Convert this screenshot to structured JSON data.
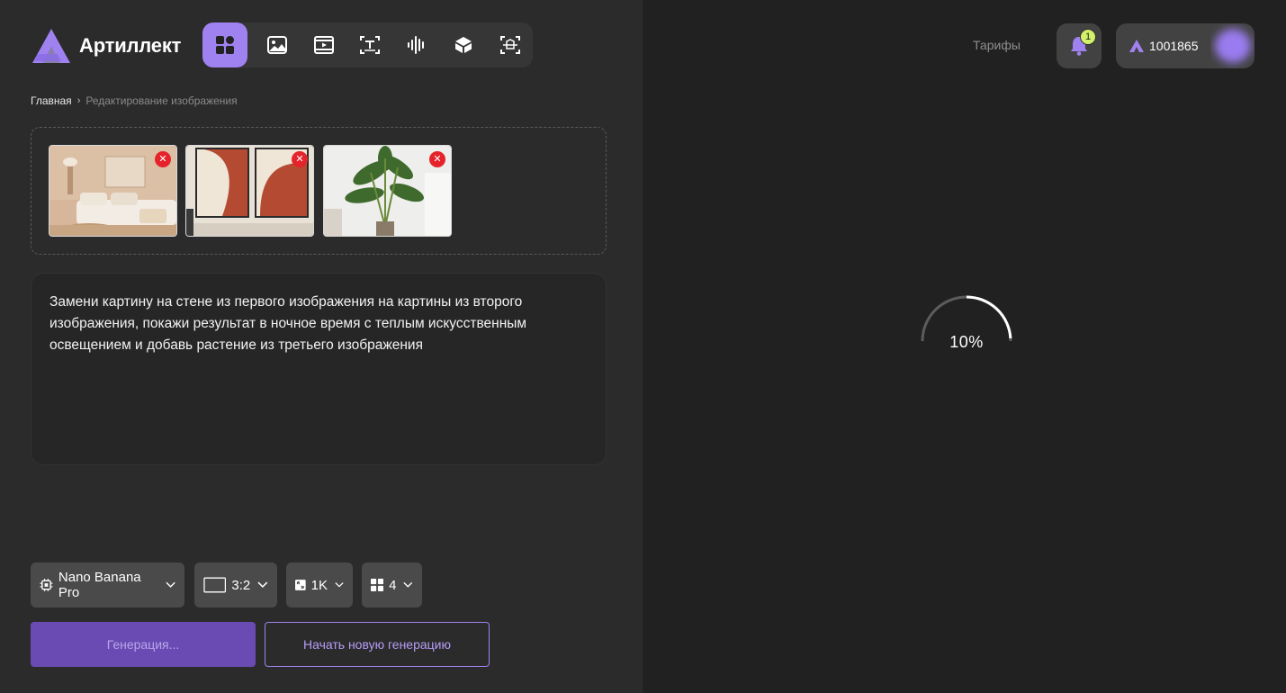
{
  "header": {
    "brand": "Артиллект",
    "toolbar": [
      {
        "name": "apps-icon",
        "active": true
      },
      {
        "name": "image-icon",
        "active": false
      },
      {
        "name": "video-icon",
        "active": false
      },
      {
        "name": "text-icon",
        "active": false
      },
      {
        "name": "audio-wave-icon",
        "active": false
      },
      {
        "name": "cube-3d-icon",
        "active": false
      },
      {
        "name": "face-scan-icon",
        "active": false
      }
    ],
    "tariffs": "Тарифы",
    "notifications_count": "1",
    "balance": "1001865"
  },
  "breadcrumb": {
    "home": "Главная",
    "separator": "›",
    "current": "Редактирование изображения"
  },
  "uploads": [
    {
      "name": "living-room-photo",
      "remove": "✕"
    },
    {
      "name": "abstract-paintings-photo",
      "remove": "✕"
    },
    {
      "name": "plant-photo",
      "remove": "✕"
    }
  ],
  "prompt": {
    "text": "Замени картину на стене из первого изображения на картины из второго изображения, покажи результат в ночное время с теплым искусственным освещением и добавь растение из третьего изображения"
  },
  "settings": {
    "model": "Nano Banana Pro",
    "aspect_ratio": "3:2",
    "resolution": "1K",
    "count": "4"
  },
  "actions": {
    "generate": "Генерация...",
    "new_generation": "Начать новую генерацию"
  },
  "progress": {
    "percent": 10,
    "label": "10%"
  },
  "colors": {
    "accent": "#9f82f0",
    "generate_button": "#6a4bb4",
    "remove_badge": "#e5232b",
    "notification_badge": "#d3f26a"
  }
}
